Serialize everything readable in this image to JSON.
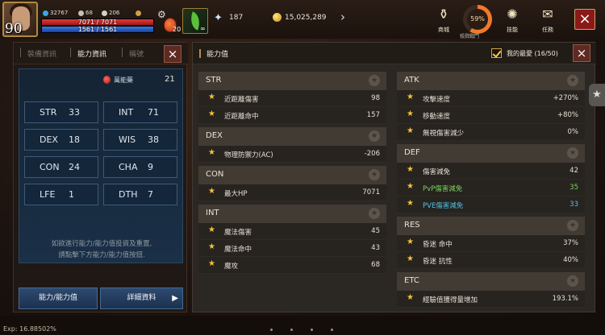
{
  "hud": {
    "level": "90",
    "stat1": "32767",
    "stat2": "68",
    "stat3": "206",
    "hp_text": "7071 / 7071",
    "hp_fraction": 1.0,
    "mp_text": "1561 / 1561",
    "mp_fraction": 1.0,
    "potion_count": "20",
    "buff_count": "∞",
    "crystal": "187",
    "gold": "15,025,289",
    "arrow": "›",
    "menu": [
      {
        "label": "商城",
        "icon": "shop-icon"
      },
      {
        "label": "技能",
        "icon": "skill-icon"
      },
      {
        "label": "任務",
        "icon": "quest-icon"
      }
    ],
    "ring_percent": "59%",
    "ring_label": "殺戮戰鬥",
    "close": "×"
  },
  "left": {
    "tabs": [
      "裝備資訊",
      "能力資訊",
      "稱號"
    ],
    "close": "×",
    "potion_label": "萬能藥",
    "potion_value": "21",
    "stats": [
      {
        "key": "STR",
        "value": "33"
      },
      {
        "key": "INT",
        "value": "71"
      },
      {
        "key": "DEX",
        "value": "18"
      },
      {
        "key": "WIS",
        "value": "38"
      },
      {
        "key": "CON",
        "value": "24"
      },
      {
        "key": "CHA",
        "value": "9"
      },
      {
        "key": "LFE",
        "value": "1"
      },
      {
        "key": "DTH",
        "value": "7"
      }
    ],
    "hint_line1": "如欲進行能力/能力值投資及重置,",
    "hint_line2": "請點擊下方能力/能力值按鈕.",
    "btn_stats": "能力/能力值",
    "btn_details": "詳細資料",
    "btn_arrow": "▶"
  },
  "right": {
    "title": "能力值",
    "fav_label": "我的最愛 (16/50)",
    "close": "×",
    "star_char": "★",
    "left_sections": [
      {
        "title": "STR",
        "rows": [
          {
            "name": "近距離傷害",
            "value": "98"
          },
          {
            "name": "近距離命中",
            "value": "157"
          }
        ]
      },
      {
        "title": "DEX",
        "rows": [
          {
            "name": "物理防禦力(AC)",
            "value": "-206"
          }
        ]
      },
      {
        "title": "CON",
        "rows": [
          {
            "name": "最大HP",
            "value": "7071"
          }
        ]
      },
      {
        "title": "INT",
        "rows": [
          {
            "name": "魔法傷害",
            "value": "45"
          },
          {
            "name": "魔法命中",
            "value": "43"
          },
          {
            "name": "魔攻",
            "value": "68"
          }
        ]
      }
    ],
    "right_sections": [
      {
        "title": "ATK",
        "rows": [
          {
            "name": "攻擊速度",
            "value": "+270%"
          },
          {
            "name": "移動速度",
            "value": "+80%"
          },
          {
            "name": "無視傷害減少",
            "value": "0%"
          }
        ]
      },
      {
        "title": "DEF",
        "rows": [
          {
            "name": "傷害減免",
            "value": "42"
          },
          {
            "name": "PvP傷害減免",
            "value": "35",
            "color": "green"
          },
          {
            "name": "PVE傷害減免",
            "value": "33",
            "color": "cyan"
          }
        ]
      },
      {
        "title": "RES",
        "rows": [
          {
            "name": "昏迷 命中",
            "value": "37%"
          },
          {
            "name": "昏迷 抗性",
            "value": "40%"
          }
        ]
      },
      {
        "title": "ETC",
        "rows": [
          {
            "name": "經驗值獲得量增加",
            "value": "193.1%"
          }
        ]
      }
    ]
  },
  "bottom": {
    "exp": "Exp: 16.88502%"
  },
  "colors": {
    "gold_star": "#f2c23a",
    "pvp_green": "#7ad25a",
    "pve_cyan": "#4cc3e6",
    "close_red": "#8a1a17"
  }
}
